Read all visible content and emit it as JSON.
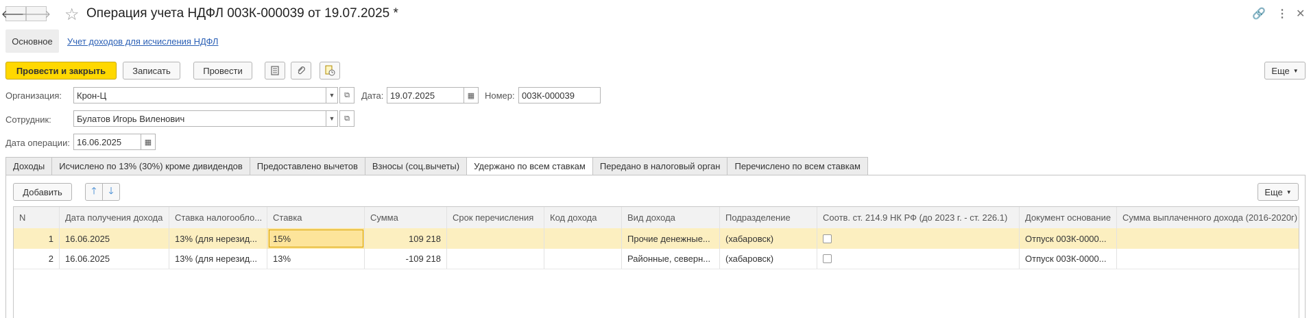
{
  "window": {
    "title": "Операция учета НДФЛ 003К-000039 от 19.07.2025 *"
  },
  "sections": {
    "main": "Основное",
    "link": "Учет доходов для исчисления НДФЛ"
  },
  "toolbar": {
    "post_close": "Провести и закрыть",
    "save": "Записать",
    "post": "Провести",
    "more": "Еще"
  },
  "form": {
    "org_label": "Организация:",
    "org_value": "Крон-Ц",
    "date_label": "Дата:",
    "date_value": "19.07.2025",
    "num_label": "Номер:",
    "num_value": "003К-000039",
    "emp_label": "Сотрудник:",
    "emp_value": "Булатов Игорь Виленович",
    "opdate_label": "Дата операции:",
    "opdate_value": "16.06.2025"
  },
  "tabs": [
    {
      "label": "Доходы"
    },
    {
      "label": "Исчислено по 13% (30%) кроме дивидендов"
    },
    {
      "label": "Предоставлено вычетов"
    },
    {
      "label": "Взносы (соц.вычеты)"
    },
    {
      "label": "Удержано по всем ставкам"
    },
    {
      "label": "Передано в налоговый орган"
    },
    {
      "label": "Перечислено по всем ставкам"
    }
  ],
  "panel": {
    "add": "Добавить",
    "more": "Еще"
  },
  "table": {
    "headers": [
      "N",
      "Дата получения дохода",
      "Ставка налогообло...",
      "Ставка",
      "Сумма",
      "Срок перечисления",
      "Код дохода",
      "Вид дохода",
      "Подразделение",
      "Соотв. ст. 214.9 НК РФ (до 2023 г. - ст. 226.1)",
      "Документ основание",
      "Сумма выплаченного дохода (2016-2020г)"
    ],
    "rows": [
      {
        "n": "1",
        "date": "16.06.2025",
        "rate_type": "13% (для нерезид...",
        "rate": "15%",
        "sum": "109 218",
        "term": "",
        "code": "",
        "kind": "Прочие денежные...",
        "dept": "(хабаровск)",
        "doc": "Отпуск 003К-0000...",
        "paid": ""
      },
      {
        "n": "2",
        "date": "16.06.2025",
        "rate_type": "13% (для нерезид...",
        "rate": "13%",
        "sum": "-109 218",
        "term": "",
        "code": "",
        "kind": "Районные, северн...",
        "dept": "(хабаровск)",
        "doc": "Отпуск 003К-0000...",
        "paid": ""
      }
    ]
  }
}
